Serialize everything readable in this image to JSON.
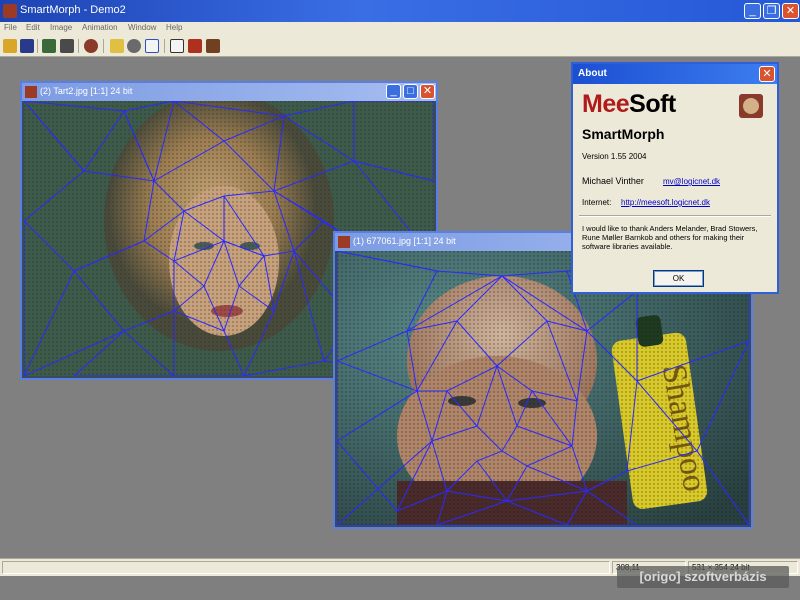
{
  "app": {
    "title": "SmartMorph - Demo2"
  },
  "menu": [
    "File",
    "Edit",
    "Image",
    "Animation",
    "Window",
    "Help"
  ],
  "toolbar_icons": [
    "open-icon",
    "save-icon",
    "batch-icon",
    "print-icon",
    "morph-icon",
    "select-icon",
    "zoom-icon",
    "fit-icon",
    "frame-icon",
    "film-icon",
    "preview-icon"
  ],
  "windows": {
    "left": {
      "title": "(2) Tart2.jpg [1:1] 24 bit"
    },
    "right": {
      "title": "(1) 677061.jpg [1:1] 24 bit"
    }
  },
  "about": {
    "title": "About",
    "brand_mee": "Mee",
    "brand_soft": "Soft",
    "product": "SmartMorph",
    "version": "Version 1.55     2004",
    "author": "Michael Vinther",
    "email": "mv@logicnet.dk",
    "internet_label": "Internet:",
    "url": "http://meesoft.logicnet.dk",
    "thanks": "I would like to thank Anders Melander, Brad Stowers, Rune Møller Barnkob and others for making their software libraries available.",
    "ok": "OK"
  },
  "status": {
    "coords": "308,11",
    "size": "531 × 354 24 bit"
  },
  "watermark": "[origo] szoftverbázis",
  "colors": {
    "titlebar": "#2558d6",
    "mesh": "#2a2aff",
    "mdi_border": "#5a7fe3",
    "desktop": "#808080"
  }
}
